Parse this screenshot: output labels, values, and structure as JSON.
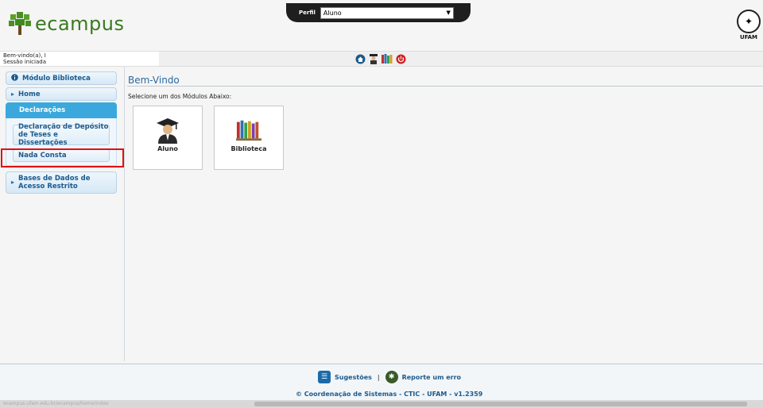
{
  "header": {
    "app_name": "ecampus",
    "profile_label": "Perfil",
    "profile_value": "Aluno",
    "university": "UFAM"
  },
  "welcome": {
    "line1": "Bem-vindo(a), I",
    "line2": "Sessão iniciada"
  },
  "top_icons": [
    "home-icon",
    "student-icon",
    "books-icon",
    "power-icon"
  ],
  "sidebar": {
    "module": "Módulo Biblioteca",
    "home": "Home",
    "section": "Declarações",
    "items": [
      "Declaração de Depósito de Teses e Dissertações",
      "Nada Consta"
    ],
    "databases": "Bases de Dados de Acesso Restrito"
  },
  "main": {
    "title": "Bem-Vindo",
    "subtitle": "Selecione um dos Módulos Abaixo:",
    "tiles": [
      {
        "label": "Aluno",
        "icon": "graduate-icon"
      },
      {
        "label": "Biblioteca",
        "icon": "books-icon"
      }
    ]
  },
  "footer": {
    "suggestions": "Sugestões",
    "separator": "|",
    "report": "Reporte um erro",
    "copyright": "© Coordenação de Sistemas - CTIC - UFAM - v1.2359"
  },
  "statusbar": {
    "url": "ecampus.ufam.edu.br/ecampus/home/index"
  },
  "colors": {
    "accent": "#3aa8dc",
    "link": "#1c5a8c",
    "highlight": "#e01010",
    "brand": "#3a7a1f"
  }
}
